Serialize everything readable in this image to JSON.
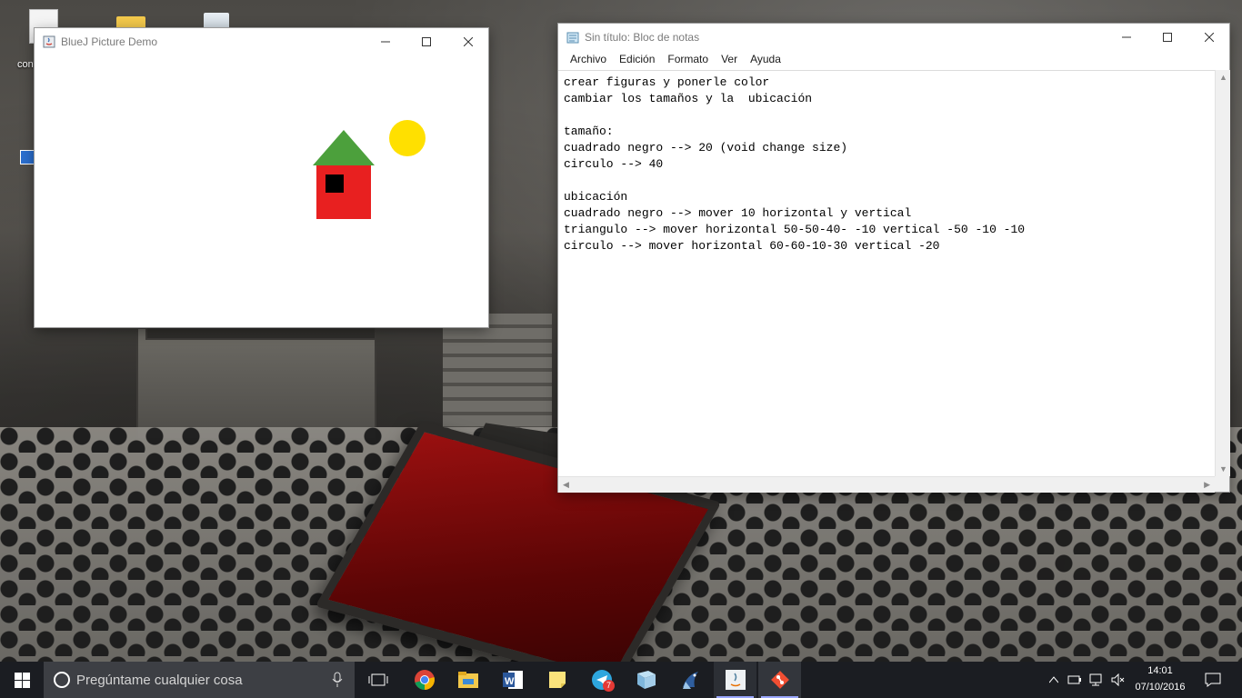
{
  "desktop": {
    "icon_label_partial": "con"
  },
  "bluej": {
    "title": "BlueJ Picture Demo",
    "shapes": {
      "house_wall_color": "#e82020",
      "roof_color": "#4ca03c",
      "window_color": "#000000",
      "sun_color": "#ffe000"
    }
  },
  "notepad": {
    "title": "Sin título: Bloc de notas",
    "menu": [
      "Archivo",
      "Edición",
      "Formato",
      "Ver",
      "Ayuda"
    ],
    "lines": [
      "crear figuras y ponerle color",
      "cambiar los tamaños y la  ubicación",
      "",
      "tamaño:",
      "cuadrado negro --> 20 (void change size)",
      "circulo --> 40",
      "",
      "ubicación",
      "cuadrado negro --> mover 10 horizontal y vertical",
      "triangulo --> mover horizontal 50-50-40- -10 vertical -50 -10 -10",
      "circulo --> mover horizontal 60-60-10-30 vertical -20"
    ]
  },
  "taskbar": {
    "search_placeholder": "Pregúntame cualquier cosa",
    "apps": [
      "chrome-icon",
      "file-explorer-icon",
      "word-icon",
      "sticky-notes-icon",
      "telegram-icon",
      "bluej-book-icon",
      "bluej-bird-icon",
      "java-icon",
      "git-icon"
    ],
    "telegram_badge": "7",
    "time": "14:01",
    "date": "07/10/2016"
  }
}
